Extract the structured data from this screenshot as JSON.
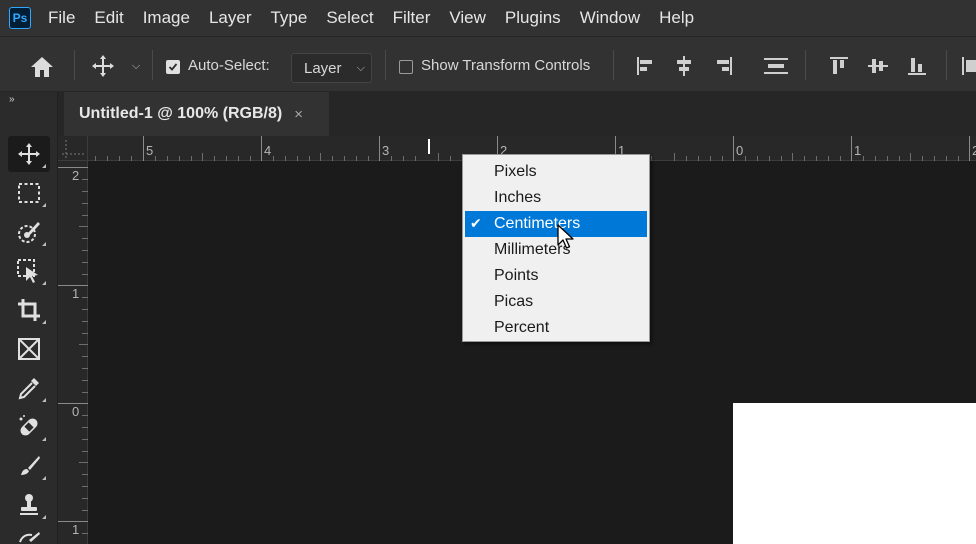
{
  "app": {
    "logo_text": "Ps"
  },
  "menubar": {
    "items": [
      "File",
      "Edit",
      "Image",
      "Layer",
      "Type",
      "Select",
      "Filter",
      "View",
      "Plugins",
      "Window",
      "Help"
    ]
  },
  "options": {
    "auto_select_label": "Auto-Select:",
    "auto_select_checked": true,
    "target_value": "Layer",
    "show_transform_label": "Show Transform Controls",
    "show_transform_checked": false
  },
  "panel": {
    "collapse_label": "»"
  },
  "tab": {
    "title": "Untitled-1 @ 100% (RGB/8)",
    "close": "×"
  },
  "ruler": {
    "h_labels": [
      "5",
      "4",
      "3",
      "2",
      "1",
      "0",
      "1",
      "2"
    ],
    "v_labels": [
      "2",
      "1",
      "0",
      "1"
    ]
  },
  "context_menu": {
    "items": [
      "Pixels",
      "Inches",
      "Centimeters",
      "Millimeters",
      "Points",
      "Picas",
      "Percent"
    ],
    "checked": "Centimeters",
    "check_mark": "✔"
  },
  "colors": {
    "accent": "#0078d7",
    "ps_blue": "#31a8ff",
    "ui_bg": "#323232",
    "canvas": "#1b1b1b"
  }
}
